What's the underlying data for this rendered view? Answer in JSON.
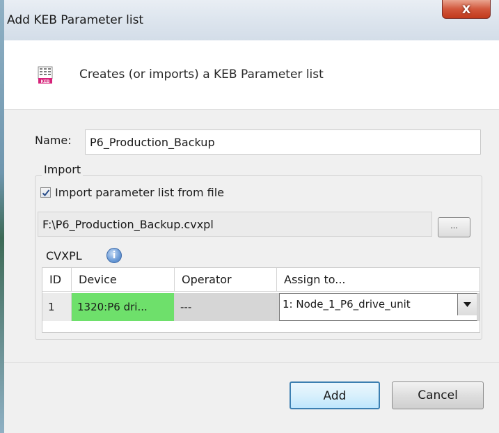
{
  "window": {
    "title": "Add KEB Parameter list",
    "close_label": "X"
  },
  "header": {
    "icon": "keb-parameter-list-icon",
    "icon_text": "KEB",
    "description": "Creates (or imports) a KEB Parameter list"
  },
  "form": {
    "name_label": "Name:",
    "name_value": "P6_Production_Backup",
    "import_group_label": "Import",
    "import_checkbox_label": "Import parameter list from file",
    "import_checked": true,
    "file_path": "F:\\P6_Production_Backup.cvxpl",
    "browse_label": "...",
    "cvxpl_label": "CVXPL",
    "info_icon": "info-icon"
  },
  "table": {
    "columns": [
      "ID",
      "Device",
      "Operator",
      "Assign to..."
    ],
    "rows": [
      {
        "id": "1",
        "device": "1320:P6 dri...",
        "operator": "---",
        "assign_to": "1: Node_1_P6_drive_unit"
      }
    ]
  },
  "footer": {
    "add_label": "Add",
    "cancel_label": "Cancel"
  },
  "colors": {
    "device_cell": "#6ee06b",
    "close_button": "#c13a1c",
    "default_button_border": "#3c7fb1"
  }
}
